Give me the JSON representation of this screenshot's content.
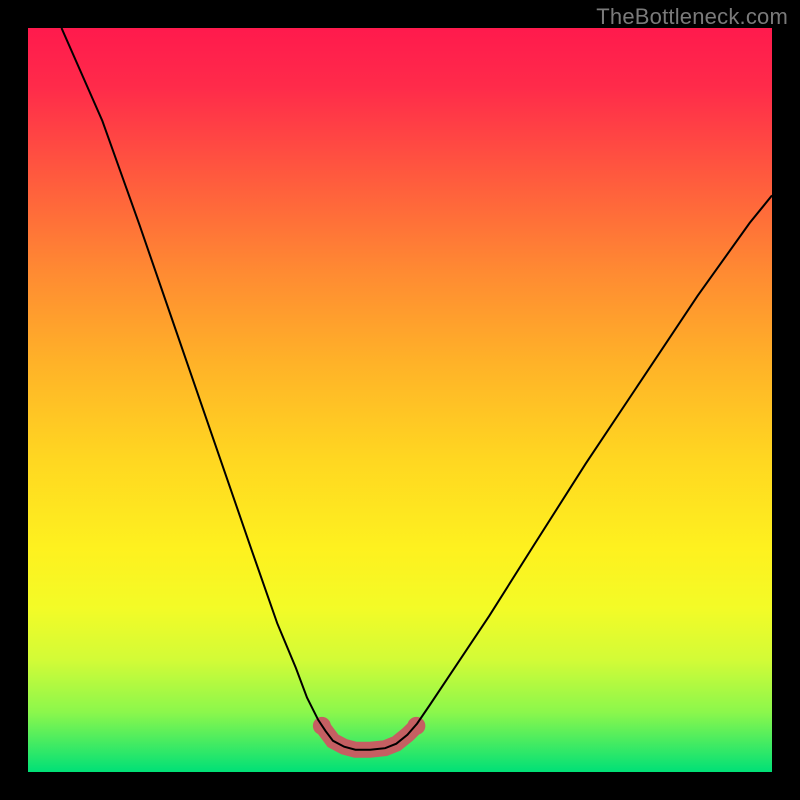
{
  "watermark": "TheBottleneck.com",
  "colors": {
    "frame": "#000000",
    "curve_thin": "#000000",
    "curve_fat": "#c55f62",
    "gradient_top": "#ff1a4d",
    "gradient_bottom": "#00e077"
  },
  "chart_data": {
    "type": "line",
    "title": "",
    "xlabel": "",
    "ylabel": "",
    "xlim": [
      0,
      1
    ],
    "ylim": [
      0,
      1
    ],
    "note": "Axes are unlabeled in the image; coordinates below are in plot-area fractions (0,0 = top-left, 1,1 = bottom-right).",
    "series": [
      {
        "name": "main-curve",
        "points": [
          {
            "x": 0.045,
            "y": 0.0
          },
          {
            "x": 0.1,
            "y": 0.125
          },
          {
            "x": 0.15,
            "y": 0.265
          },
          {
            "x": 0.2,
            "y": 0.41
          },
          {
            "x": 0.25,
            "y": 0.555
          },
          {
            "x": 0.3,
            "y": 0.7
          },
          {
            "x": 0.335,
            "y": 0.8
          },
          {
            "x": 0.36,
            "y": 0.86
          },
          {
            "x": 0.375,
            "y": 0.9
          },
          {
            "x": 0.39,
            "y": 0.93
          },
          {
            "x": 0.4,
            "y": 0.945
          },
          {
            "x": 0.41,
            "y": 0.958
          },
          {
            "x": 0.425,
            "y": 0.966
          },
          {
            "x": 0.44,
            "y": 0.97
          },
          {
            "x": 0.46,
            "y": 0.97
          },
          {
            "x": 0.48,
            "y": 0.968
          },
          {
            "x": 0.495,
            "y": 0.962
          },
          {
            "x": 0.51,
            "y": 0.95
          },
          {
            "x": 0.523,
            "y": 0.935
          },
          {
            "x": 0.54,
            "y": 0.91
          },
          {
            "x": 0.57,
            "y": 0.865
          },
          {
            "x": 0.62,
            "y": 0.79
          },
          {
            "x": 0.68,
            "y": 0.695
          },
          {
            "x": 0.75,
            "y": 0.585
          },
          {
            "x": 0.82,
            "y": 0.48
          },
          {
            "x": 0.9,
            "y": 0.36
          },
          {
            "x": 0.97,
            "y": 0.262
          },
          {
            "x": 1.0,
            "y": 0.225
          }
        ]
      },
      {
        "name": "optimal-zone-highlight",
        "points": [
          {
            "x": 0.395,
            "y": 0.938
          },
          {
            "x": 0.41,
            "y": 0.958
          },
          {
            "x": 0.425,
            "y": 0.966
          },
          {
            "x": 0.44,
            "y": 0.97
          },
          {
            "x": 0.46,
            "y": 0.97
          },
          {
            "x": 0.48,
            "y": 0.968
          },
          {
            "x": 0.495,
            "y": 0.962
          },
          {
            "x": 0.51,
            "y": 0.95
          },
          {
            "x": 0.522,
            "y": 0.938
          }
        ]
      }
    ],
    "highlight_endpoints": [
      {
        "x": 0.395,
        "y": 0.938
      },
      {
        "x": 0.522,
        "y": 0.938
      }
    ]
  }
}
